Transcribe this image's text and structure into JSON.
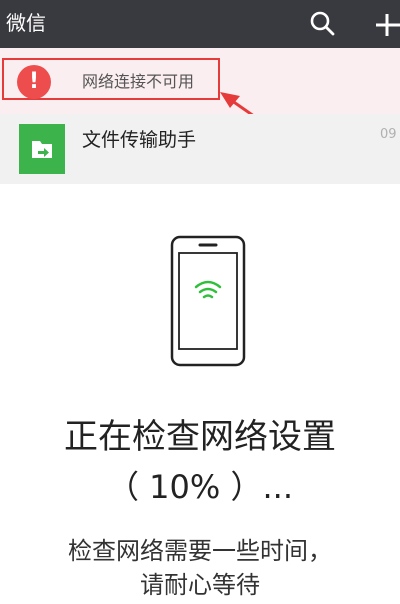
{
  "header": {
    "app_title": "微信",
    "search_icon": "search-icon",
    "plus_icon": "plus-icon",
    "background": "#393a3f"
  },
  "banner": {
    "icon": "alert-icon",
    "text": "网络连接不可用",
    "accent": "#e63b3b"
  },
  "chats": [
    {
      "name": "文件传输助手",
      "time": "09",
      "icon": "file-transfer-icon"
    }
  ],
  "network_check": {
    "title": "正在检查网络设置",
    "progress_text": "（ 10% ）...",
    "progress": 0.1,
    "desc_line1": "检查网络需要一些时间，",
    "desc_line2": "请耐心等待",
    "icon": "wifi-icon",
    "wifi_color": "#2fbf3a"
  }
}
